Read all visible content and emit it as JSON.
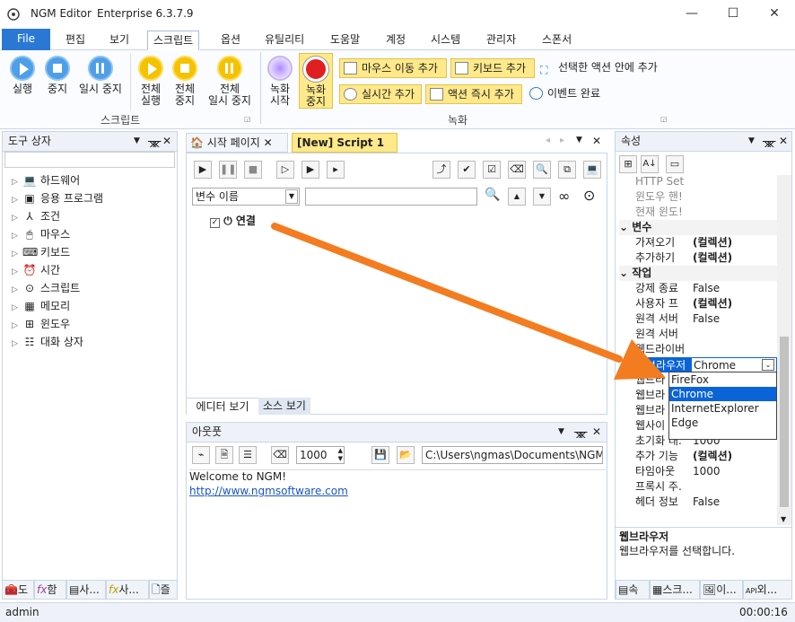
{
  "window": {
    "app": "NGM Editor",
    "edition": "Enterprise 6.3.7.9"
  },
  "menu": {
    "file": "File",
    "items": [
      "편집",
      "보기",
      "스크립트",
      "옵션",
      "유틸리티",
      "도움말",
      "계정",
      "시스템",
      "관리자",
      "스폰서"
    ]
  },
  "ribbon": {
    "script_group": "스크립트",
    "record_group": "녹화",
    "buttons": {
      "run": "실행",
      "stop": "중지",
      "pause": "일시 중지",
      "run_all": "전체\n실행",
      "stop_all": "전체\n중지",
      "pause_all": "전체\n일시 중지",
      "rec_start": "녹화\n시작",
      "rec_stop": "녹화\n중지",
      "mouse_move": "마우스 이동 추가",
      "keyboard": "키보드 추가",
      "add_in_selected": "선택한 액션 안에 추가",
      "realtime": "실시간 추가",
      "instant": "액션 즉시 추가",
      "event_done": "이벤트 완료"
    }
  },
  "toolbox": {
    "title": "도구 상자",
    "items": [
      "하드웨어",
      "응용 프로그램",
      "조건",
      "마우스",
      "키보드",
      "시간",
      "스크립트",
      "메모리",
      "윈도우",
      "대화 상자"
    ]
  },
  "tabs": {
    "start_page": "시작 페이지",
    "script": "[New] Script 1"
  },
  "editor": {
    "var_placeholder": "변수 이름",
    "node_label": "연결",
    "view_tabs": [
      "에디터 보기",
      "소스 보기"
    ]
  },
  "output": {
    "title": "아웃풋",
    "count": "1000",
    "path": "C:\\Users\\ngmas\\Documents\\NGM6\\",
    "welcome": "Welcome to NGM!",
    "link": "http://www.ngmsoftware.com"
  },
  "properties": {
    "title": "속성",
    "rows_top": [
      {
        "label": "HTTP Set",
        "value": ""
      },
      {
        "label": "윈도우 핸!",
        "value": ""
      },
      {
        "label": "현재 윈도!",
        "value": ""
      }
    ],
    "cat_var": "변수",
    "var_rows": [
      {
        "label": "가져오기",
        "value": "(컬렉션)"
      },
      {
        "label": "추가하기",
        "value": "(컬렉션)"
      }
    ],
    "cat_job": "작업",
    "job_rows": [
      {
        "label": "강제 종료",
        "value": "False"
      },
      {
        "label": "사용자 프",
        "value": "(컬렉션)"
      },
      {
        "label": "원격 서버",
        "value": "False"
      },
      {
        "label": "원격 서버",
        "value": ""
      },
      {
        "label": "웹드라이버",
        "value": ""
      },
      {
        "label": "웹브라우저",
        "value": "Chrome"
      },
      {
        "label": "웹드라",
        "value": ""
      },
      {
        "label": "웹브라",
        "value": ""
      },
      {
        "label": "웹브라",
        "value": ""
      },
      {
        "label": "웹사이",
        "value": ""
      },
      {
        "label": "초기화 대.",
        "value": "1000"
      },
      {
        "label": "추가 기능",
        "value": "(컬렉션)"
      },
      {
        "label": "타임아웃",
        "value": "1000"
      },
      {
        "label": "프록시 주.",
        "value": ""
      },
      {
        "label": "헤더 정보",
        "value": "False"
      }
    ],
    "dropdown": [
      "FireFox",
      "Chrome",
      "InternetExplorer",
      "Edge"
    ],
    "desc_title": "웹브라우저",
    "desc_text": "웹브라우저를 선택합니다.",
    "bottom_tabs": [
      "속",
      "스크...",
      "이...",
      "외..."
    ]
  },
  "left_bottom_tabs": [
    "도",
    "함",
    "사...",
    "사...",
    "즐"
  ],
  "status": {
    "user": "admin",
    "time": "00:00:16"
  }
}
